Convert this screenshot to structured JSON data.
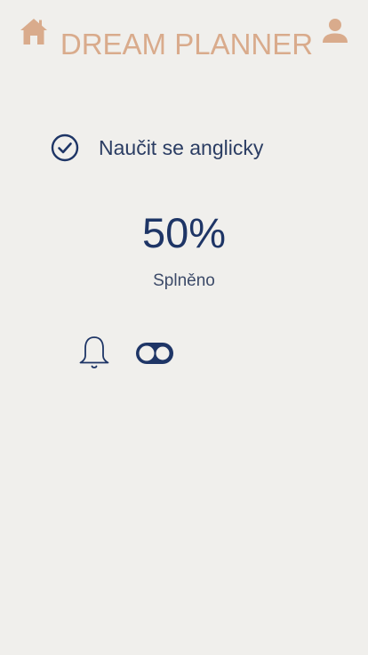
{
  "header": {
    "title": "DREAM PLANNER",
    "home_icon": "home-icon",
    "user_icon": "user-icon",
    "accent_color": "#d9ab8c"
  },
  "goal": {
    "label": "Naučit se anglicky",
    "status_icon": "check-circle-icon",
    "progress_text": "50%",
    "progress_value": 0.5,
    "status_label": "Splněno"
  },
  "notifications": {
    "icon": "bell-icon",
    "toggle_state": "off"
  },
  "colors": {
    "background": "#f0efec",
    "primary": "#1e3566"
  }
}
